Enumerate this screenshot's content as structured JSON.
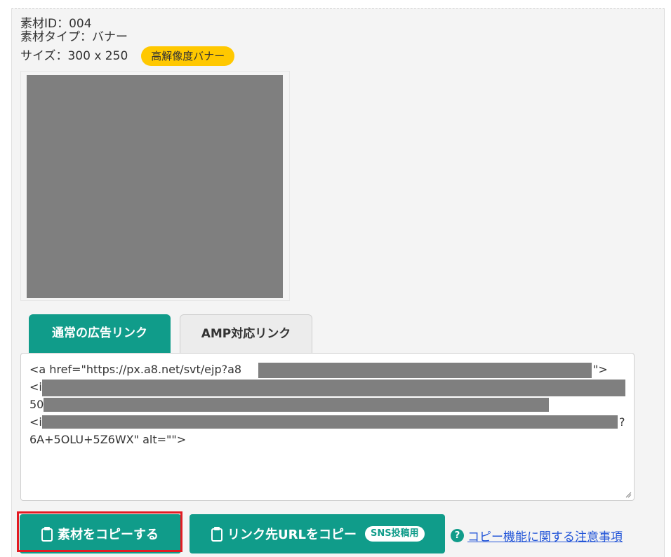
{
  "material": {
    "id_line": "素材ID：004",
    "type_line": "素材タイプ：バナー",
    "size_line": "サイズ：300 x 250",
    "badge": "高解像度バナー"
  },
  "tabs": [
    {
      "label": "通常の広告リンク",
      "active": true
    },
    {
      "label": "AMP対応リンク",
      "active": false
    }
  ],
  "code": {
    "line1_start": "<a href=\"https://px.a8.net/svt/ejp?a8",
    "line1_end": "\">",
    "line2_start": "<i",
    "line3_start": "50",
    "line4_start": "<i",
    "line4_end": "?",
    "line5": "6A+5OLU+5Z6WX\" alt=\"\">"
  },
  "buttons": {
    "copy_material": "素材をコピーする",
    "copy_url": "リンク先URLをコピー",
    "sns_badge": "SNS投稿用"
  },
  "help": {
    "icon": "?",
    "link": "コピー機能に関する注意事項"
  },
  "colors": {
    "accent": "#109c8a",
    "badge": "#ffc800",
    "highlight": "#e31b23",
    "link": "#2456d8",
    "redaction": "#7f7f7f"
  }
}
